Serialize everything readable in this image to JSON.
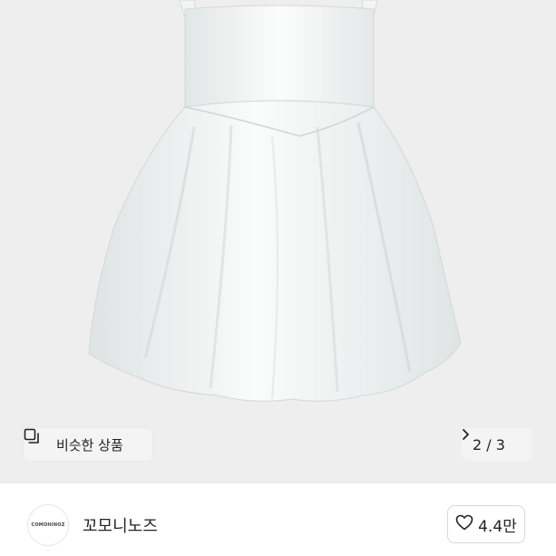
{
  "product_image": {
    "similar_button": {
      "icon": "similar-items-icon",
      "label": "비슷한 상품"
    },
    "pager": {
      "current": "2",
      "separator": "/",
      "total": "3",
      "icon": "chevron-right-icon"
    }
  },
  "seller": {
    "avatar_logo_text": "COMOHINOZ",
    "name": "꼬모니노즈",
    "likes": {
      "icon": "heart-outline-icon",
      "count": "4.4만"
    }
  }
}
